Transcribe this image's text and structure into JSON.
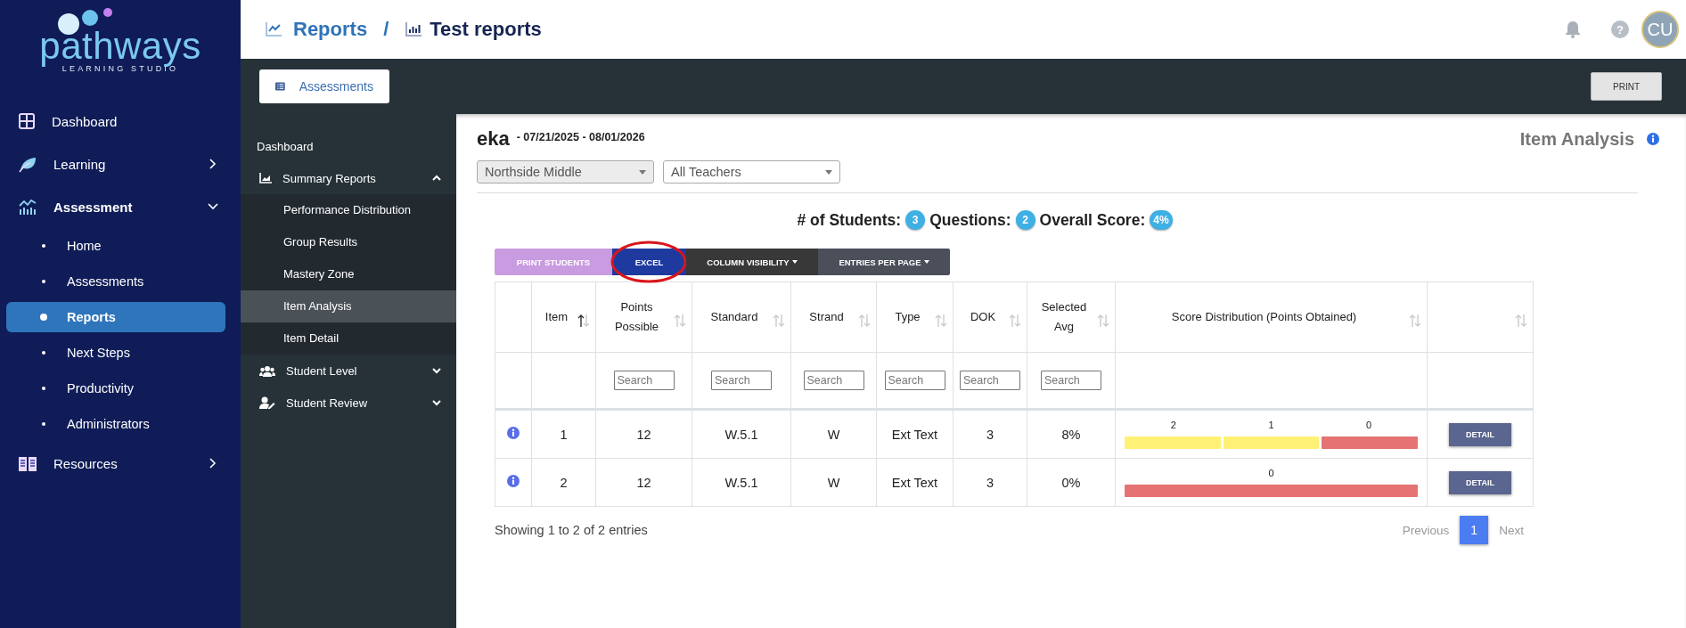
{
  "brand": {
    "name": "pathways",
    "tagline": "LEARNING STUDIO"
  },
  "nav": [
    {
      "label": "Dashboard",
      "selected": false
    },
    {
      "label": "Learning",
      "selected": false,
      "expanded": false
    },
    {
      "label": "Assessment",
      "selected": false,
      "expanded": true,
      "children": [
        {
          "label": "Home",
          "selected": false
        },
        {
          "label": "Assessments",
          "selected": false
        },
        {
          "label": "Reports",
          "selected": true
        },
        {
          "label": "Next Steps",
          "selected": false
        },
        {
          "label": "Productivity",
          "selected": false
        },
        {
          "label": "Administrators",
          "selected": false
        }
      ]
    },
    {
      "label": "Resources",
      "selected": false,
      "expanded": false
    }
  ],
  "header": {
    "breadcrumb": [
      {
        "label": "Reports"
      },
      {
        "label": "Test reports"
      }
    ],
    "separator": "/",
    "help": "?",
    "avatar": "CU"
  },
  "toolbar": {
    "assessments_button": "Assessments",
    "print_button": "PRINT"
  },
  "subnav": [
    {
      "label": "Dashboard"
    },
    {
      "label": "Summary Reports",
      "expanded": true,
      "children": [
        {
          "label": "Performance Distribution",
          "selected": false
        },
        {
          "label": "Group Results",
          "selected": false
        },
        {
          "label": "Mastery Zone",
          "selected": false
        },
        {
          "label": "Item Analysis",
          "selected": true
        },
        {
          "label": "Item Detail",
          "selected": false
        }
      ]
    },
    {
      "label": "Student Level",
      "expanded": false
    },
    {
      "label": "Student Review",
      "expanded": false
    }
  ],
  "report": {
    "title": "eka",
    "date_range": "- 07/21/2025 - 08/01/2026",
    "page_title": "Item Analysis",
    "filters": [
      {
        "value": "Northside Middle",
        "disabled": true
      },
      {
        "value": "All Teachers",
        "disabled": false
      }
    ],
    "stats": [
      {
        "label": "# of Students:",
        "value": "3"
      },
      {
        "label": "Questions:",
        "value": "2"
      },
      {
        "label": "Overall Score:",
        "value": "4%"
      }
    ],
    "table_buttons": [
      {
        "label": "PRINT STUDENTS",
        "color": "#c99be0",
        "dropdown": false,
        "circled": false
      },
      {
        "label": "EXCEL",
        "color": "#1f3a9f",
        "dropdown": false,
        "circled": true
      },
      {
        "label": "COLUMN VISIBILITY",
        "color": "#383838",
        "dropdown": true,
        "circled": false
      },
      {
        "label": "ENTRIES PER PAGE",
        "color": "#4a4f5a",
        "dropdown": true,
        "circled": false
      }
    ],
    "columns": [
      {},
      {
        "label": "Item",
        "sorted": true
      },
      {
        "label": "Points Possible",
        "sorted": false,
        "search_placeholder": "Search"
      },
      {
        "label": "Standard",
        "sorted": false,
        "search_placeholder": "Search"
      },
      {
        "label": "Strand",
        "sorted": false,
        "search_placeholder": "Search"
      },
      {
        "label": "Type",
        "sorted": false,
        "search_placeholder": "Search"
      },
      {
        "label": "DOK",
        "sorted": false,
        "search_placeholder": "Search"
      },
      {
        "label": "Selected Avg",
        "sorted": false,
        "search_placeholder": "Search"
      },
      {
        "label": "Score Distribution (Points Obtained)",
        "sorted": false
      },
      {
        "sorted": false
      }
    ],
    "rows": [
      {
        "cells": [
          "",
          "1",
          "12",
          "W.5.1",
          "W",
          "Ext Text",
          "3",
          "8%"
        ],
        "distribution": [
          {
            "label": "2",
            "color": "#fff176"
          },
          {
            "label": "1",
            "color": "#fff176"
          },
          {
            "label": "0",
            "color": "#e57373"
          }
        ],
        "action": "DETAIL"
      },
      {
        "cells": [
          "",
          "2",
          "12",
          "W.5.1",
          "W",
          "Ext Text",
          "3",
          "0%"
        ],
        "distribution": [
          {
            "label": "0",
            "color": "#e57373"
          }
        ],
        "action": "DETAIL"
      }
    ],
    "footer": {
      "info": "Showing 1 to 2 of 2 entries",
      "previous": {
        "label": "Previous",
        "disabled": true
      },
      "pages": [
        {
          "label": "1",
          "selected": true
        }
      ],
      "next": {
        "label": "Next",
        "disabled": true
      }
    }
  }
}
